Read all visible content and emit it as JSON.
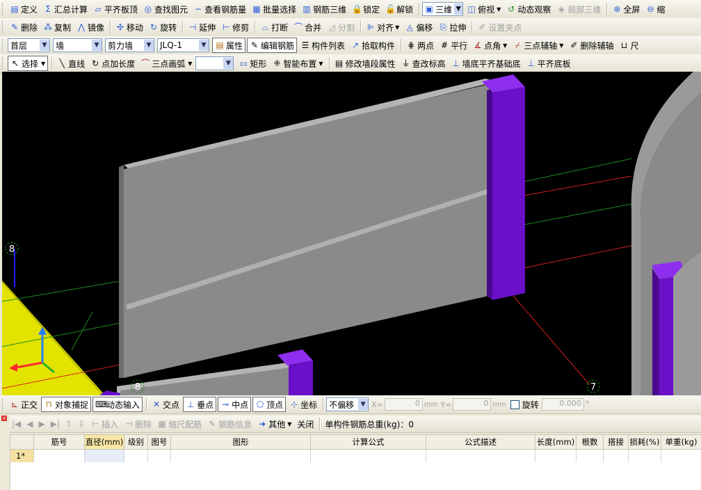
{
  "toolbar1": {
    "items": [
      {
        "icon": "define-icon",
        "label": "定义",
        "sym": "▤"
      },
      {
        "icon": "sum-icon",
        "label": "汇总计算",
        "sym": "Σ"
      },
      {
        "icon": "level-slab-icon",
        "label": "平齐板顶",
        "sym": "▱"
      },
      {
        "icon": "binoculars-icon",
        "label": "查找图元",
        "sym": "◎"
      },
      {
        "icon": "rebar-view-icon",
        "label": "查看钢筋量",
        "sym": "∽"
      },
      {
        "icon": "batch-select-icon",
        "label": "批量选择",
        "sym": "▦"
      },
      {
        "icon": "rebar-3d-icon",
        "label": "钢筋三维",
        "sym": "▥"
      },
      {
        "icon": "lock-icon",
        "label": "锁定",
        "sym": "🔒"
      },
      {
        "icon": "unlock-icon",
        "label": "解锁",
        "sym": "🔓"
      }
    ],
    "view_mode": "三维",
    "view_angle": "俯视",
    "dynamic": "动态观察",
    "local3d": "局部三维",
    "fullscreen": "全屏",
    "zoomout": "缩"
  },
  "toolbar2": {
    "items": [
      {
        "icon": "delete-icon",
        "label": "删除",
        "sym": "✎",
        "dis": false
      },
      {
        "icon": "copy-icon",
        "label": "复制",
        "sym": "⁂",
        "dis": false
      },
      {
        "icon": "mirror-icon",
        "label": "镜像",
        "sym": "⋀",
        "dis": false
      },
      {
        "icon": "move-icon",
        "label": "移动",
        "sym": "✣",
        "dis": false
      },
      {
        "icon": "rotate-icon",
        "label": "旋转",
        "sym": "↻",
        "dis": false
      },
      {
        "icon": "extend-icon",
        "label": "延伸",
        "sym": "⊣",
        "dis": false
      },
      {
        "icon": "trim-icon",
        "label": "修剪",
        "sym": "⊢",
        "dis": false
      },
      {
        "icon": "break-icon",
        "label": "打断",
        "sym": "⌓",
        "dis": false
      },
      {
        "icon": "merge-icon",
        "label": "合并",
        "sym": "⌒",
        "dis": false
      },
      {
        "icon": "split-icon",
        "label": "分割",
        "sym": "◿",
        "dis": true
      },
      {
        "icon": "align-icon",
        "label": "对齐",
        "sym": "⊫",
        "dis": false
      },
      {
        "icon": "offset-icon",
        "label": "偏移",
        "sym": "◬",
        "dis": false
      },
      {
        "icon": "stretch-icon",
        "label": "拉伸",
        "sym": "⎘",
        "dis": false
      },
      {
        "icon": "grip-point-icon",
        "label": "设置夹点",
        "sym": "✐",
        "dis": true
      }
    ]
  },
  "toolbar3": {
    "floor": "首层",
    "category": "墙",
    "type": "剪力墙",
    "component": "JLQ-1",
    "properties": "属性",
    "edit_rebar": "编辑钢筋",
    "component_list": "构件列表",
    "pick_component": "拾取构件",
    "two_points": "两点",
    "parallel": "平行",
    "point_angle": "点角",
    "three_point_axis": "三点辅轴",
    "delete_axis": "删除辅轴",
    "more": "尺"
  },
  "toolbar4": {
    "select": "选择",
    "line": "直线",
    "point_length": "点加长度",
    "arc": "三点画弧",
    "rect": "矩形",
    "smart_layout": "智能布置",
    "modify_wall_props": "修改墙段属性",
    "check_elevation": "查改标高",
    "wall_bottom_align": "墙底平齐基础底",
    "level_base": "平齐底板"
  },
  "viewport": {
    "axis_labels": [
      "8",
      "8",
      "7"
    ],
    "colors": {
      "wall": "#8a8a8a",
      "wall_top": "#b4b4b4",
      "column": "#6a10c8",
      "column_top": "#8e2ff0",
      "axis_red": "#d42020",
      "axis_green": "#1d8a1d",
      "slab": "#e0e000"
    }
  },
  "snapbar": {
    "ortho": "正交",
    "object_snap": "对象捕捉",
    "dynamic_input": "动态输入",
    "intersection": "交点",
    "perpendicular": "垂点",
    "midpoint": "中点",
    "vertex": "顶点",
    "coordinate": "坐标",
    "offset_mode": "不偏移",
    "x_label": "X=",
    "x_value": "0",
    "y_label": "Y=",
    "y_value": "0",
    "unit": "mm",
    "rotate": "旋转",
    "rotate_value": "0.000",
    "deg": "°"
  },
  "panelbar": {
    "insert": "插入",
    "delete": "删除",
    "scale_rebar": "缩尺配筋",
    "rebar_info": "钢筋信息",
    "other": "其他",
    "close": "关闭",
    "total_weight": "单构件钢筋总重(kg)：0"
  },
  "grid": {
    "headers": [
      "",
      "筋号",
      "直径(mm)",
      "级别",
      "图号",
      "图形",
      "计算公式",
      "公式描述",
      "长度(mm)",
      "根数",
      "搭接",
      "损耗(%)",
      "单重(kg)"
    ],
    "rows": [
      [
        "1*",
        "",
        "",
        "",
        "",
        "",
        "",
        "",
        "",
        "",
        "",
        "",
        ""
      ]
    ]
  }
}
